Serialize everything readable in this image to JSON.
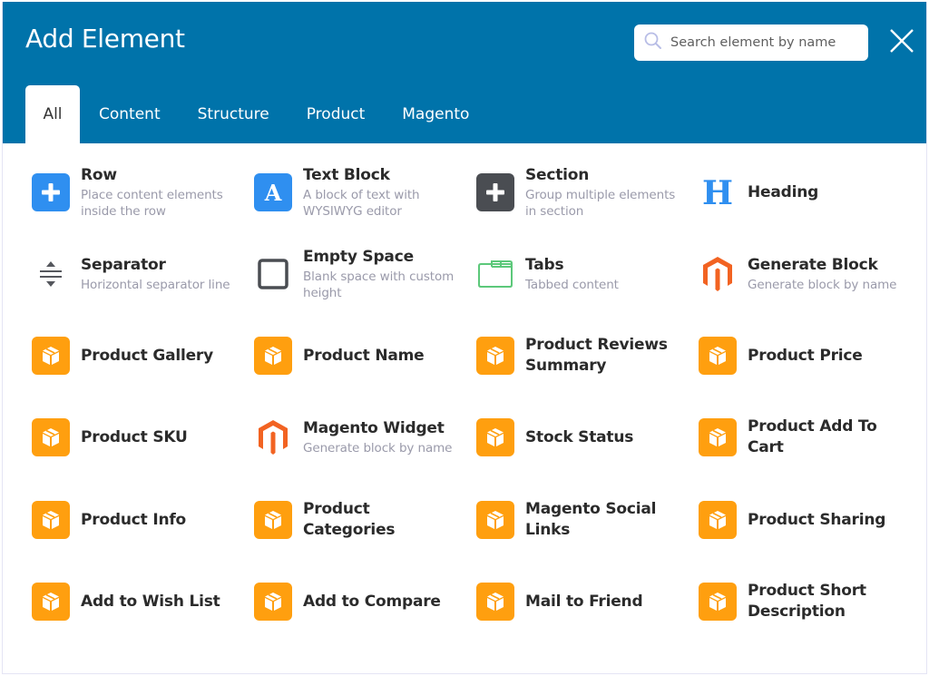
{
  "dialog": {
    "title": "Add Element",
    "search": {
      "placeholder": "Search element by name",
      "value": ""
    },
    "close_icon": "close-icon"
  },
  "tabs": [
    {
      "label": "All",
      "active": true
    },
    {
      "label": "Content",
      "active": false
    },
    {
      "label": "Structure",
      "active": false
    },
    {
      "label": "Product",
      "active": false
    },
    {
      "label": "Magento",
      "active": false
    }
  ],
  "colors": {
    "header": "#0073aa",
    "blue_icon": "#2f8ff0",
    "dark_icon": "#4a4d52",
    "orange_icon": "#ff9f0f",
    "magento_orange": "#f26322",
    "tabs_green": "#5cc87a"
  },
  "elements": [
    {
      "name": "Row",
      "description": "Place content elements inside the row",
      "icon": "plus-blue-icon"
    },
    {
      "name": "Text Block",
      "description": "A block of text with WYSIWYG editor",
      "icon": "text-a-icon"
    },
    {
      "name": "Section",
      "description": "Group multiple elements in section",
      "icon": "plus-dark-icon"
    },
    {
      "name": "Heading",
      "description": "",
      "icon": "heading-h-icon"
    },
    {
      "name": "Separator",
      "description": "Horizontal separator line",
      "icon": "separator-icon"
    },
    {
      "name": "Empty Space",
      "description": "Blank space with custom height",
      "icon": "empty-square-icon"
    },
    {
      "name": "Tabs",
      "description": "Tabbed content",
      "icon": "tabs-icon"
    },
    {
      "name": "Generate Block",
      "description": "Generate block by name",
      "icon": "magento-logo-icon"
    },
    {
      "name": "Product Gallery",
      "description": "",
      "icon": "box-icon"
    },
    {
      "name": "Product Name",
      "description": "",
      "icon": "box-icon"
    },
    {
      "name": "Product Reviews Summary",
      "description": "",
      "icon": "box-icon"
    },
    {
      "name": "Product Price",
      "description": "",
      "icon": "box-icon"
    },
    {
      "name": "Product SKU",
      "description": "",
      "icon": "box-icon"
    },
    {
      "name": "Magento Widget",
      "description": "Generate block by name",
      "icon": "magento-logo-icon"
    },
    {
      "name": "Stock Status",
      "description": "",
      "icon": "box-icon"
    },
    {
      "name": "Product Add To Cart",
      "description": "",
      "icon": "box-icon"
    },
    {
      "name": "Product Info",
      "description": "",
      "icon": "box-icon"
    },
    {
      "name": "Product Categories",
      "description": "",
      "icon": "box-icon"
    },
    {
      "name": "Magento Social Links",
      "description": "",
      "icon": "box-icon"
    },
    {
      "name": "Product Sharing",
      "description": "",
      "icon": "box-icon"
    },
    {
      "name": "Add to Wish List",
      "description": "",
      "icon": "box-icon"
    },
    {
      "name": "Add to Compare",
      "description": "",
      "icon": "box-icon"
    },
    {
      "name": "Mail to Friend",
      "description": "",
      "icon": "box-icon"
    },
    {
      "name": "Product Short Description",
      "description": "",
      "icon": "box-icon"
    }
  ]
}
